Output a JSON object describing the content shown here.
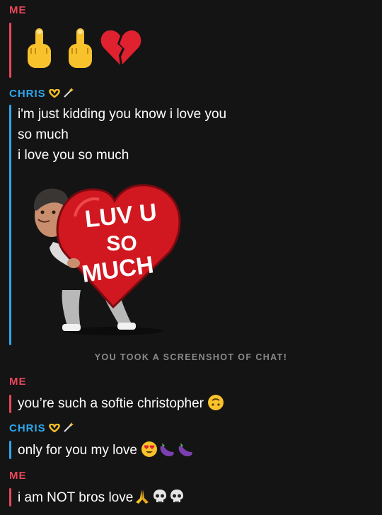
{
  "chat": {
    "section1": {
      "sender": "ME"
    },
    "section2": {
      "sender": "CHRIS",
      "line1": "i'm just kidding you know i love you",
      "line2": "so much",
      "line3": "i love you so much",
      "sticker": {
        "line1": "LUV U",
        "line2": "SO",
        "line3": "MUCH"
      }
    },
    "system_notice": "YOU TOOK A SCREENSHOT OF CHAT!",
    "section3": {
      "sender": "ME",
      "text": "you’re such a softie christopher"
    },
    "section4": {
      "sender": "CHRIS",
      "text": "only for you my love"
    },
    "section5": {
      "sender": "ME",
      "text": "i am NOT bros love"
    }
  },
  "colors": {
    "background": "#141414",
    "me": "#e8465a",
    "chris": "#2ea8ee",
    "system_text": "#8a8a8a"
  },
  "icons": [
    "middle-finger-emoji",
    "broken-heart-emoji",
    "heart-hands-emoji",
    "magic-wand-emoji",
    "heart-eyes-emoji",
    "eggplant-emoji",
    "upside-down-face-emoji",
    "folded-hands-emoji",
    "skull-emoji"
  ]
}
